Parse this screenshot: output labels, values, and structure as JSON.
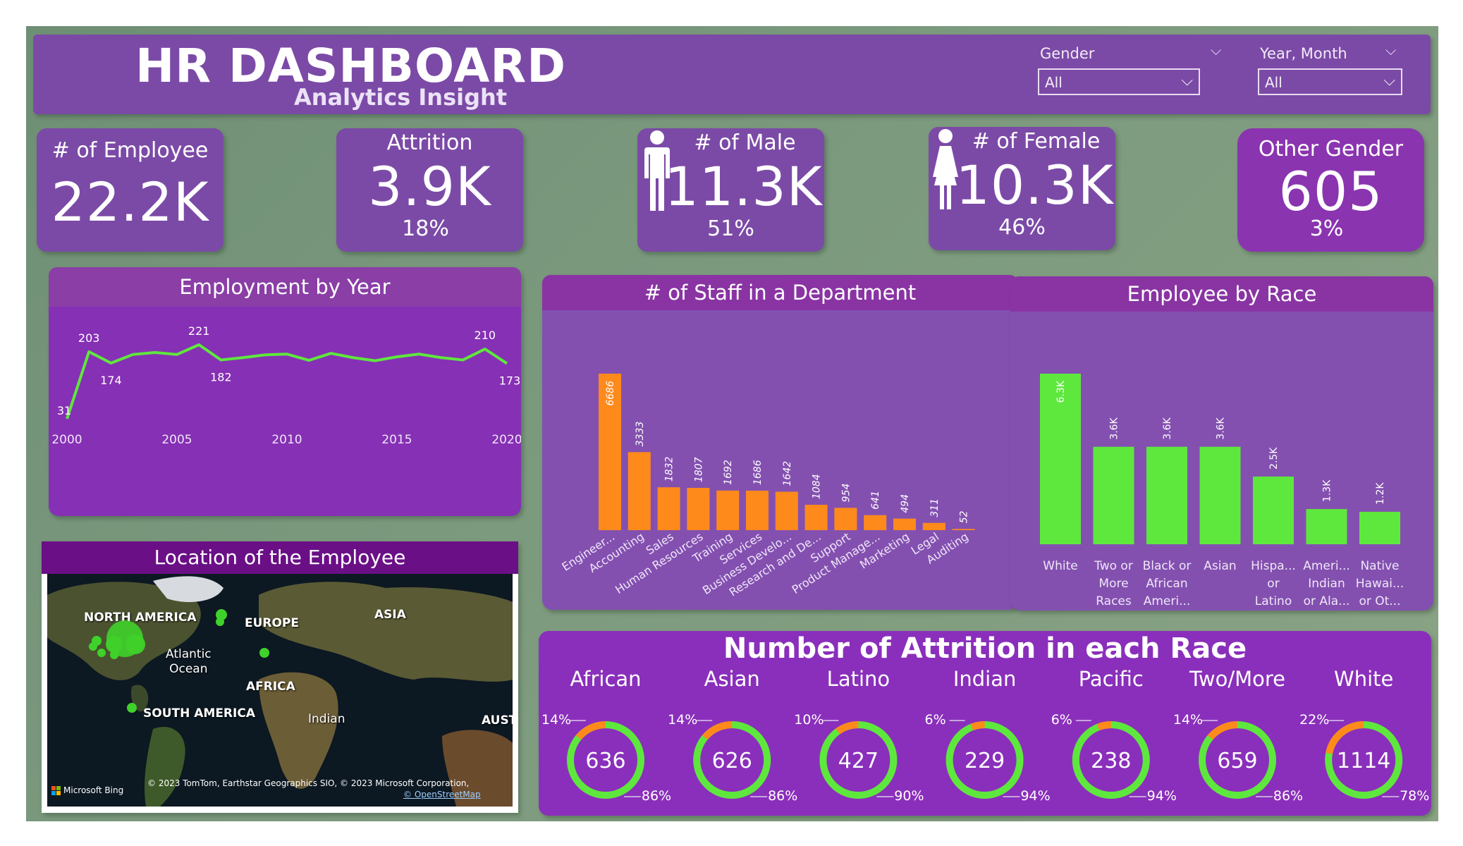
{
  "header": {
    "title": "HR DASHBOARD",
    "subtitle": "Analytics Insight"
  },
  "slicers": [
    {
      "label": "Gender",
      "value": "All"
    },
    {
      "label": "Year, Month",
      "value": "All"
    }
  ],
  "kpis": {
    "employees": {
      "title": "# of Employee",
      "value": "22.2K"
    },
    "attrition": {
      "title": "Attrition",
      "value": "3.9K",
      "pct": "18%"
    },
    "male": {
      "title": "# of Male",
      "value": "11.3K",
      "pct": "51%"
    },
    "female": {
      "title": "# of Female",
      "value": "10.3K",
      "pct": "46%"
    },
    "other": {
      "title": "Other Gender",
      "value": "605",
      "pct": "3%"
    }
  },
  "map": {
    "title": "Location of the Employee",
    "labels": {
      "north_america": "NORTH AMERICA",
      "europe": "EUROPE",
      "asia": "ASIA",
      "atlantic": "Atlantic\nOcean",
      "africa": "AFRICA",
      "south_america": "SOUTH AMERICA",
      "indian": "Indian",
      "aust": "AUST"
    },
    "credit": "© 2023 TomTom, Earthstar Geographics SIO, © 2023 Microsoft Corporation,",
    "osm": "© OpenStreetMap",
    "bing": "Microsoft Bing"
  },
  "attrition_race": {
    "title": "Number of Attrition in each Race",
    "items": [
      {
        "name": "African",
        "value": "636",
        "attr_pct": "14%",
        "rest_pct": "86%",
        "attr": 14
      },
      {
        "name": "Asian",
        "value": "626",
        "attr_pct": "14%",
        "rest_pct": "86%",
        "attr": 14
      },
      {
        "name": "Latino",
        "value": "427",
        "attr_pct": "10%",
        "rest_pct": "90%",
        "attr": 10
      },
      {
        "name": "Indian",
        "value": "229",
        "attr_pct": "6%",
        "rest_pct": "94%",
        "attr": 6
      },
      {
        "name": "Pacific",
        "value": "238",
        "attr_pct": "6%",
        "rest_pct": "94%",
        "attr": 6
      },
      {
        "name": "Two/More",
        "value": "659",
        "attr_pct": "14%",
        "rest_pct": "86%",
        "attr": 14
      },
      {
        "name": "White",
        "value": "1114",
        "attr_pct": "22%",
        "rest_pct": "78%",
        "attr": 22
      }
    ]
  },
  "colors": {
    "panel": "#7b4aa6",
    "header": "#8a34a4",
    "green": "#5ee83d",
    "orange": "#ff8a1c"
  },
  "chart_data": [
    {
      "type": "line",
      "title": "Employment by Year",
      "x": [
        2000,
        2001,
        2002,
        2003,
        2004,
        2005,
        2006,
        2007,
        2008,
        2009,
        2010,
        2011,
        2012,
        2013,
        2014,
        2015,
        2016,
        2017,
        2018,
        2019,
        2020
      ],
      "values": [
        31,
        203,
        174,
        196,
        201,
        196,
        221,
        182,
        188,
        195,
        197,
        181,
        199,
        188,
        180,
        190,
        197,
        188,
        182,
        210,
        173
      ],
      "data_labels": {
        "2000": "31",
        "2001": "203",
        "2002": "174",
        "2006": "221",
        "2007": "182",
        "2019": "210",
        "2020": "173"
      },
      "x_ticks": [
        "2000",
        "2005",
        "2010",
        "2015",
        "2020"
      ],
      "xlim": [
        2000,
        2020
      ],
      "ylim": [
        0,
        240
      ],
      "grid": false
    },
    {
      "type": "bar",
      "title": "# of Staff in a Department",
      "categories": [
        "Engineer...",
        "Accounting",
        "Sales",
        "Human Resources",
        "Training",
        "Services",
        "Business Develo...",
        "Research and De...",
        "Support",
        "Product Manage...",
        "Marketing",
        "Legal",
        "Auditing"
      ],
      "values": [
        6686,
        3333,
        1832,
        1807,
        1692,
        1686,
        1642,
        1084,
        954,
        641,
        494,
        311,
        52
      ],
      "ylim": [
        0,
        7000
      ]
    },
    {
      "type": "bar",
      "title": "Employee by Race",
      "categories": [
        "White",
        "Two or More Races",
        "Black or African Ameri...",
        "Asian",
        "Hispa... or Latino",
        "Ameri... Indian or Ala...",
        "Native Hawai... or Ot..."
      ],
      "values": [
        6300,
        3600,
        3600,
        3600,
        2500,
        1300,
        1200
      ],
      "data_labels": [
        "6.3K",
        "3.6K",
        "3.6K",
        "3.6K",
        "2.5K",
        "1.3K",
        "1.2K"
      ],
      "ylim": [
        0,
        6500
      ]
    }
  ]
}
